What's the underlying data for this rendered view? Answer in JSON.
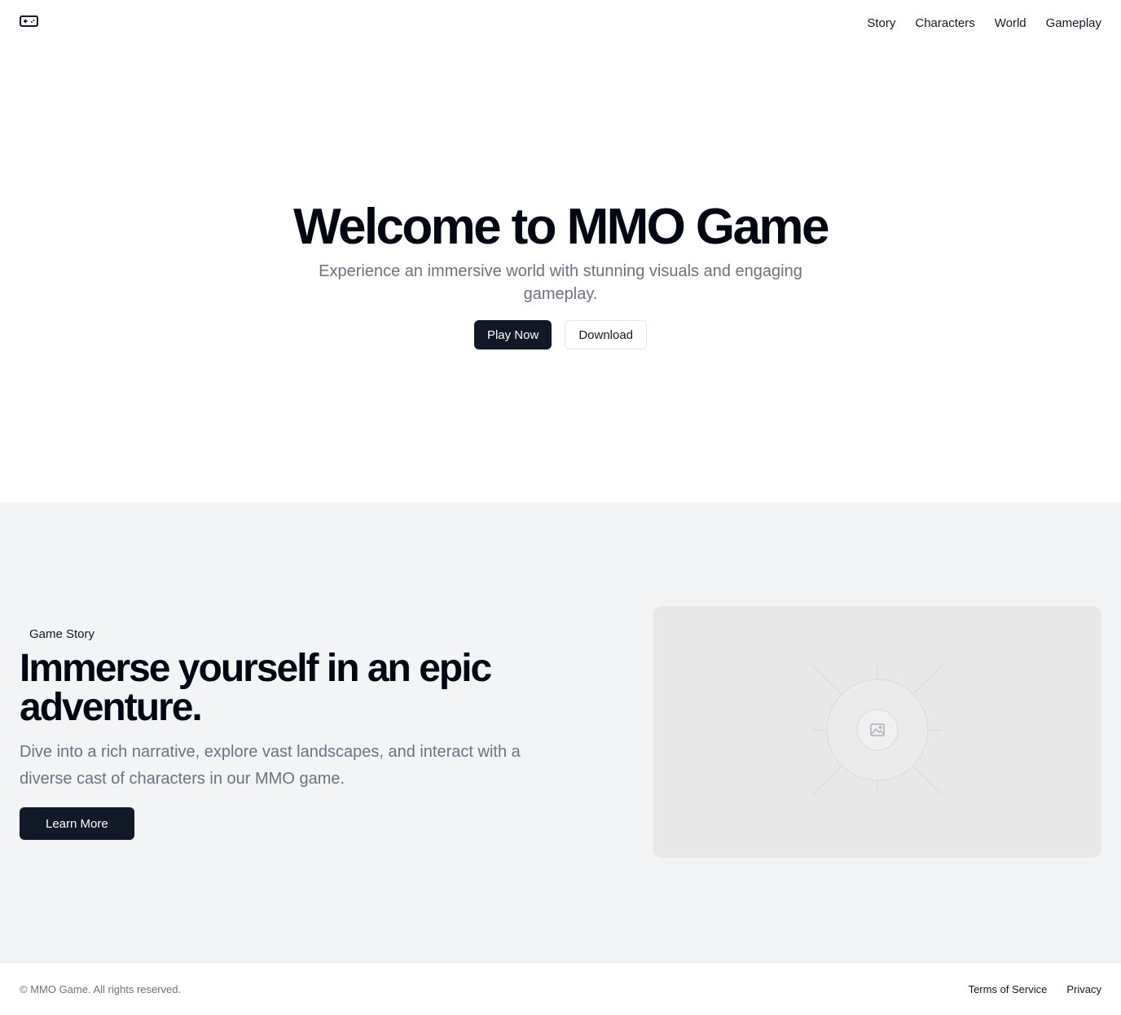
{
  "header": {
    "logo_icon": "gamepad-icon",
    "nav": [
      {
        "label": "Story"
      },
      {
        "label": "Characters"
      },
      {
        "label": "World"
      },
      {
        "label": "Gameplay"
      }
    ]
  },
  "hero": {
    "title": "Welcome to MMO Game",
    "subtitle": "Experience an immersive world with stunning visuals and engaging gameplay.",
    "primary_button": "Play Now",
    "secondary_button": "Download"
  },
  "story": {
    "badge": "Game Story",
    "heading": "Immerse yourself in an epic adventure.",
    "description": "Dive into a rich narrative, explore vast landscapes, and interact with a diverse cast of characters in our MMO game.",
    "button": "Learn More",
    "image_icon": "image-placeholder-icon"
  },
  "footer": {
    "copyright": "© MMO Game. All rights reserved.",
    "links": [
      {
        "label": "Terms of Service"
      },
      {
        "label": "Privacy"
      }
    ]
  },
  "colors": {
    "primary": "#111827",
    "muted_text": "#6b7280",
    "section_bg": "#f2f4f6",
    "placeholder_bg": "#e8e8e8"
  }
}
